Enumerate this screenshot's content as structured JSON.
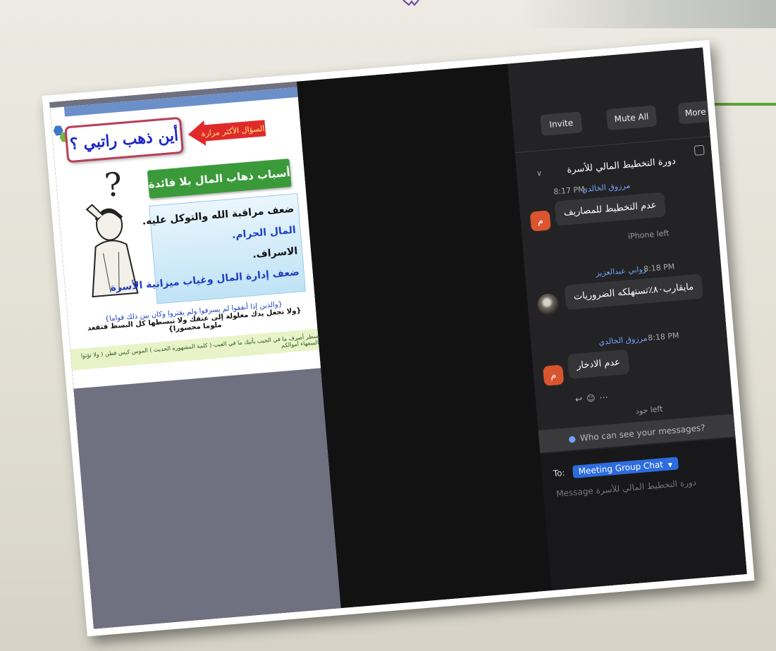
{
  "slide": {
    "title": "أين ذهب راتبي ؟",
    "arrow_label": "السؤال الأكثر مرارة",
    "banner": "أسباب ذهاب المال بلا فائدة",
    "reasons": [
      {
        "text": "ضعف مراقبة الله والتوكل عليه.",
        "color": "#111111"
      },
      {
        "text": "المال الحرام.",
        "color": "#1f3fc0"
      },
      {
        "text": "الاسراف.",
        "color": "#111111"
      },
      {
        "text": "ضعف إدارة المال وغياب ميزانية الأسرة",
        "color": "#1f3fc0"
      }
    ],
    "verse_1": "{والذين إذا أنفقوا لم يسرفوا ولم يقتروا وكان بين ذلك قواما}",
    "verse_2": "{ولا تجعل يدك مغلولة إلى عنقك ولا تبسطها كل البسط فتقعد ملوما محسورا}",
    "footer_strip": "سطر أصرف ما في الجيب يأتيك ما في الغيب ( كلمة المشهورة الحديث ) الموس كيس فطن ( ولا تؤتوا السفهاء أموالكم"
  },
  "toolbar": {
    "invite_label": "Invite",
    "mute_all_label": "Mute All",
    "more_label": "More"
  },
  "chat": {
    "title": "دورة التخطيط المالي للأسرة",
    "messages": [
      {
        "sender": "مرزوق الخالدي",
        "time": "8:17 PM",
        "text": "عدم التخطيط للمصاريف",
        "avatar": "م",
        "note": "iPhone left"
      },
      {
        "sender": "روابي عبدالعزيز",
        "time": "8:18 PM",
        "text": "مايقارب٨٠٪تستهلكه الضروريات"
      },
      {
        "sender": "مرزوق الخالدي",
        "time": "8:18 PM",
        "text": "عدم الادخار",
        "avatar": "م",
        "note": "جود left"
      }
    ],
    "who_can_see": "Who can see your messages?",
    "to_label": "To:",
    "recipient": "Meeting Group Chat",
    "message_placeholder": "Message دورة التخطيط المالي للأسرة"
  }
}
